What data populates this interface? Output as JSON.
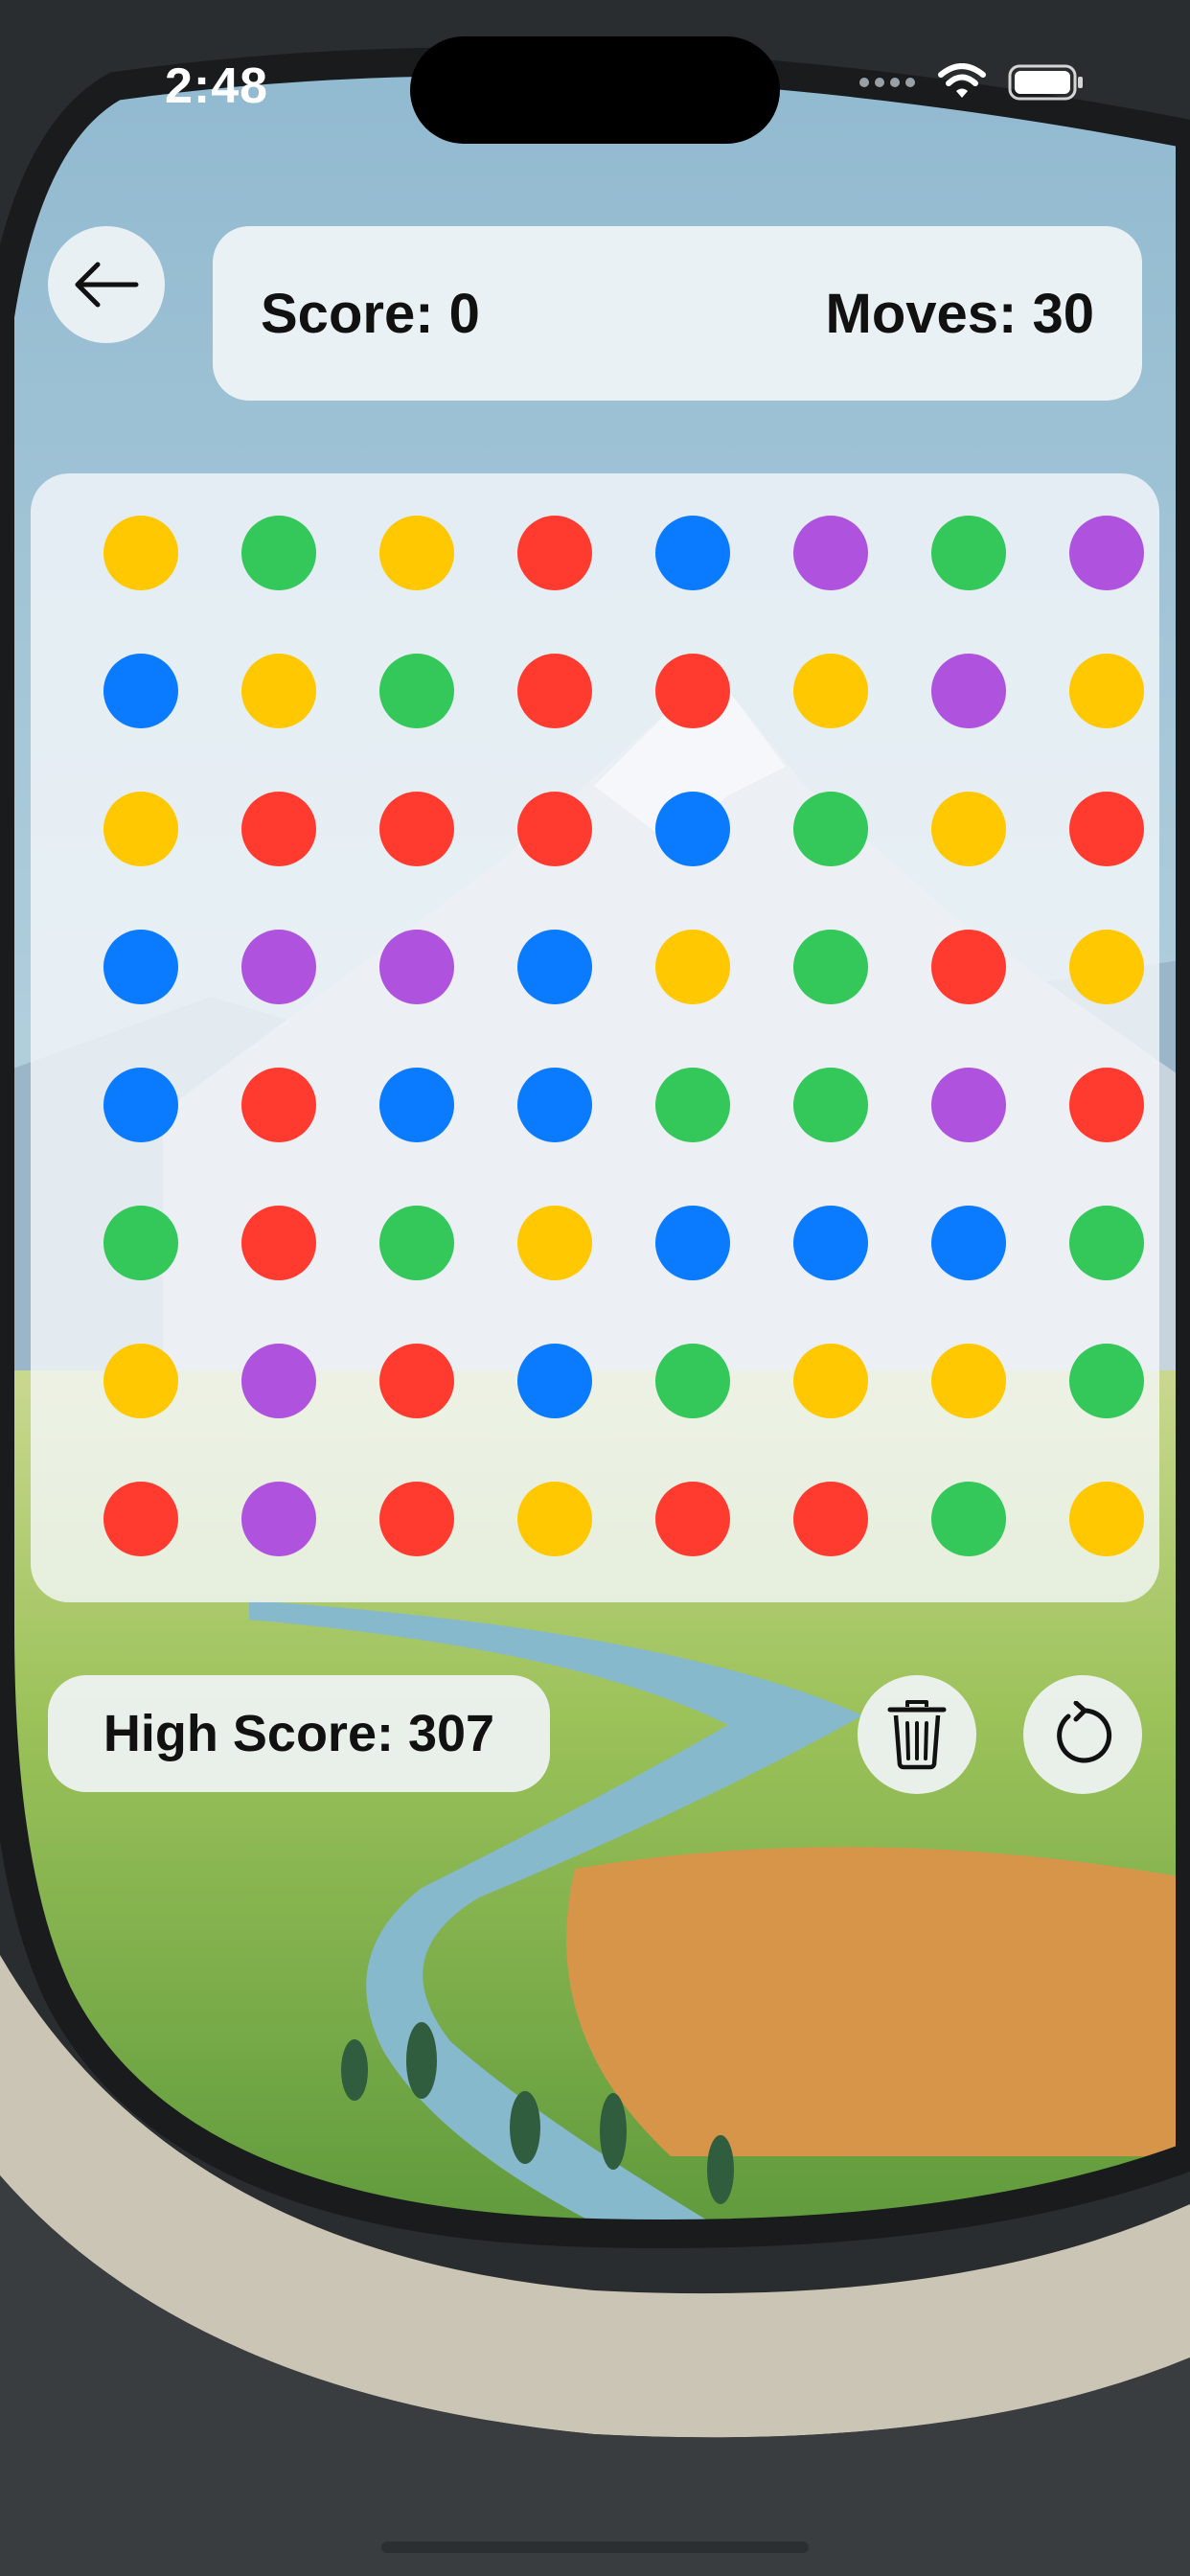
{
  "status_bar": {
    "time": "2:48",
    "icons": [
      "signal-icon",
      "wifi-icon",
      "battery-icon"
    ]
  },
  "header": {
    "back_icon": "arrow-left-icon",
    "score_label": "Score: 0",
    "moves_label": "Moves: 30"
  },
  "board": {
    "rows": 8,
    "cols": 8,
    "palette": {
      "yellow": "#FFC800",
      "green": "#34C759",
      "red": "#FF3B30",
      "blue": "#0A7AFF",
      "purple": "#AF52DE"
    },
    "grid": [
      [
        "yellow",
        "green",
        "yellow",
        "red",
        "blue",
        "purple",
        "green",
        "purple"
      ],
      [
        "blue",
        "yellow",
        "green",
        "red",
        "red",
        "yellow",
        "purple",
        "yellow"
      ],
      [
        "yellow",
        "red",
        "red",
        "red",
        "blue",
        "green",
        "yellow",
        "red"
      ],
      [
        "blue",
        "purple",
        "purple",
        "blue",
        "yellow",
        "green",
        "red",
        "yellow"
      ],
      [
        "blue",
        "red",
        "blue",
        "blue",
        "green",
        "green",
        "purple",
        "red"
      ],
      [
        "green",
        "red",
        "green",
        "yellow",
        "blue",
        "blue",
        "blue",
        "green"
      ],
      [
        "yellow",
        "purple",
        "red",
        "blue",
        "green",
        "yellow",
        "yellow",
        "green"
      ],
      [
        "red",
        "purple",
        "red",
        "yellow",
        "red",
        "red",
        "green",
        "yellow"
      ]
    ]
  },
  "footer": {
    "high_score_label": "High Score: 307",
    "trash_icon": "trash-icon",
    "restart_icon": "restart-icon"
  }
}
